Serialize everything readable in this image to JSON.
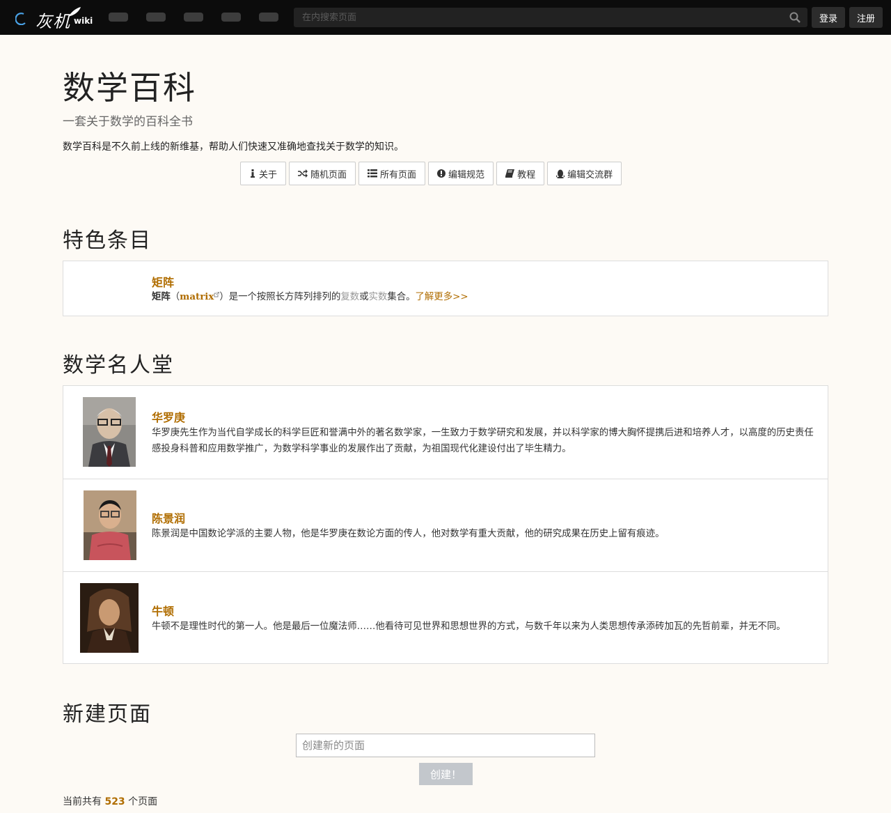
{
  "header": {
    "logo_text": "灰机",
    "logo_suffix": "wiki",
    "search_placeholder": "在内搜索页面",
    "login_label": "登录",
    "register_label": "注册"
  },
  "main": {
    "title": "数学百科",
    "subtitle": "一套关于数学的百科全书",
    "description": "数学百科是不久前上线的新维基，帮助人们快速又准确地查找关于数学的知识。",
    "buttons": [
      {
        "label": "关于",
        "icon": "info-icon"
      },
      {
        "label": "随机页面",
        "icon": "shuffle-icon"
      },
      {
        "label": "所有页面",
        "icon": "list-icon"
      },
      {
        "label": "编辑规范",
        "icon": "alert-circle-icon"
      },
      {
        "label": "教程",
        "icon": "book-icon"
      },
      {
        "label": "编辑交流群",
        "icon": "qq-icon"
      }
    ]
  },
  "featured": {
    "heading": "特色条目",
    "name": "矩阵",
    "text_bold": "矩阵",
    "text_paren_open": "（",
    "text_link": "matrix",
    "text_paren_close": "）",
    "text_mid": "是一个按照长方阵列排列的",
    "text_grey1": "复数",
    "text_or": "或",
    "text_grey2": "实数",
    "text_end": "集合。",
    "more_label": "了解更多>>"
  },
  "hall": {
    "heading": "数学名人堂",
    "people": [
      {
        "name": "华罗庚",
        "text": "华罗庚先生作为当代自学成长的科学巨匠和誉满中外的著名数学家，一生致力于数学研究和发展，并以科学家的博大胸怀提携后进和培养人才，以高度的历史责任感投身科普和应用数学推广，为数学科学事业的发展作出了贡献，为祖国现代化建设付出了毕生精力。"
      },
      {
        "name": "陈景润",
        "text": "陈景润是中国数论学派的主要人物，他是华罗庚在数论方面的传人，他对数学有重大贡献，他的研究成果在历史上留有痕迹。"
      },
      {
        "name": "牛顿",
        "text": "牛顿不是理性时代的第一人。他是最后一位魔法师……他看待可见世界和思想世界的方式，与数千年以来为人类思想传承添砖加瓦的先哲前辈，并无不同。"
      }
    ]
  },
  "create": {
    "heading": "新建页面",
    "input_placeholder": "创建新的页面",
    "button_label": "创建！",
    "count_prefix": "当前共有",
    "count_value": "523",
    "count_suffix": "个页面"
  }
}
